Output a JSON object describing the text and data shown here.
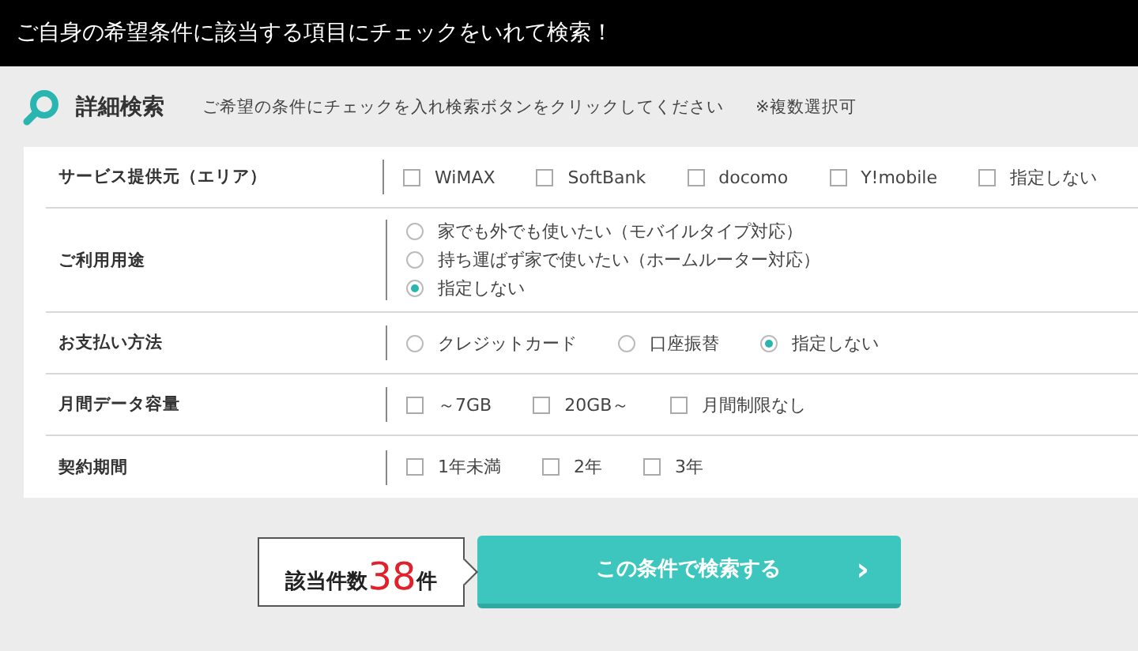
{
  "banner": {
    "text": "ご自身の希望条件に該当する項目にチェックをいれて検索！"
  },
  "heading": {
    "title": "詳細検索",
    "description": "ご希望の条件にチェックを入れ検索ボタンをクリックしてください",
    "note": "※複数選択可"
  },
  "rows": [
    {
      "label": "サービス提供元（エリア）",
      "options": [
        {
          "kind": "checkbox",
          "label": "WiMAX",
          "checked": false
        },
        {
          "kind": "checkbox",
          "label": "SoftBank",
          "checked": false
        },
        {
          "kind": "checkbox",
          "label": "docomo",
          "checked": false
        },
        {
          "kind": "checkbox",
          "label": "Y!mobile",
          "checked": false
        },
        {
          "kind": "checkbox",
          "label": "指定しない",
          "checked": false
        }
      ]
    },
    {
      "label": "ご利用用途",
      "options": [
        {
          "kind": "radio",
          "label": "家でも外でも使いたい（モバイルタイプ対応）",
          "checked": false
        },
        {
          "kind": "radio",
          "label": "持ち運ばず家で使いたい（ホームルーター対応）",
          "checked": false
        },
        {
          "kind": "radio",
          "label": "指定しない",
          "checked": true
        }
      ]
    },
    {
      "label": "お支払い方法",
      "options": [
        {
          "kind": "radio",
          "label": "クレジットカード",
          "checked": false
        },
        {
          "kind": "radio",
          "label": "口座振替",
          "checked": false
        },
        {
          "kind": "radio",
          "label": "指定しない",
          "checked": true
        }
      ]
    },
    {
      "label": "月間データ容量",
      "options": [
        {
          "kind": "checkbox",
          "label": "～7GB",
          "checked": false
        },
        {
          "kind": "checkbox",
          "label": "20GB～",
          "checked": false
        },
        {
          "kind": "checkbox",
          "label": "月間制限なし",
          "checked": false
        }
      ]
    },
    {
      "label": "契約期間",
      "options": [
        {
          "kind": "checkbox",
          "label": "1年未満",
          "checked": false
        },
        {
          "kind": "checkbox",
          "label": "2年",
          "checked": false
        },
        {
          "kind": "checkbox",
          "label": "3年",
          "checked": false
        }
      ]
    }
  ],
  "result": {
    "label": "該当件数",
    "count": "38",
    "unit": "件"
  },
  "search_button": {
    "label": "この条件で検索する",
    "arrow": "›"
  }
}
